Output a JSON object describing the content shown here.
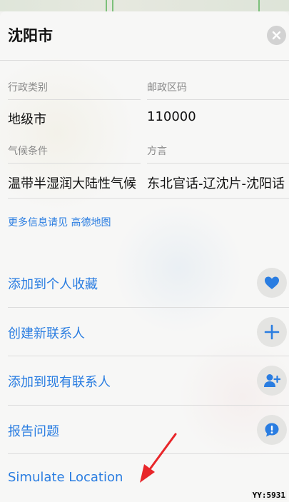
{
  "header": {
    "title": "沈阳市"
  },
  "info": {
    "admin_type_label": "行政类别",
    "admin_type_value": "地级市",
    "postal_label": "邮政区码",
    "postal_value": "110000",
    "climate_label": "气候条件",
    "climate_value": "温带半湿润大陆性气候",
    "dialect_label": "方言",
    "dialect_value": "东北官话-辽沈片-沈阳话"
  },
  "more": {
    "prefix": "更多信息请见",
    "source": "高德地图"
  },
  "actions": [
    {
      "label": "添加到个人收藏",
      "icon": "heart-icon"
    },
    {
      "label": "创建新联系人",
      "icon": "plus-icon"
    },
    {
      "label": "添加到现有联系人",
      "icon": "add-person-icon"
    },
    {
      "label": "报告问题",
      "icon": "exclamation-bubble-icon"
    },
    {
      "label": "Simulate Location"
    }
  ],
  "watermark": "YY:5931",
  "colors": {
    "accent": "#2a7de1",
    "arrow": "#e8262a"
  }
}
